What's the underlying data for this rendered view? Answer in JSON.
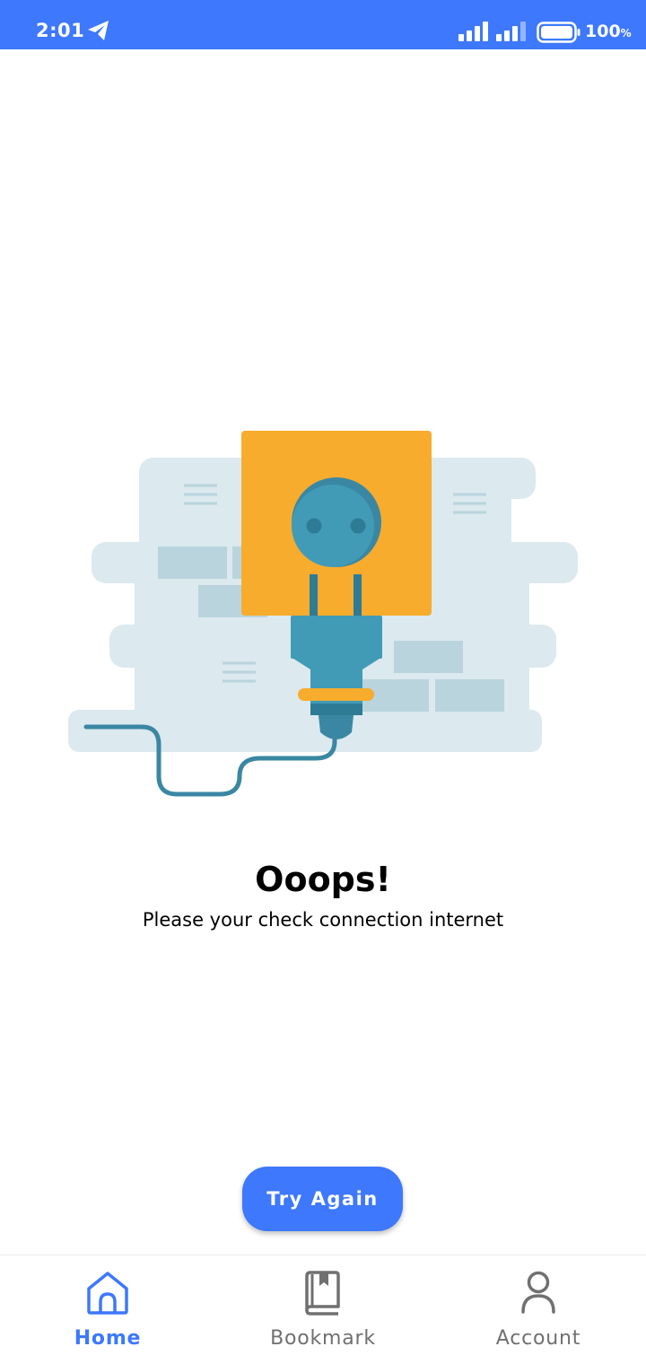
{
  "status_bar": {
    "time": "2:01",
    "battery_value": "100",
    "battery_unit": "%",
    "background_color": "#3d78fd"
  },
  "error": {
    "title": "Ooops!",
    "message": "Please your check connection internet"
  },
  "actions": {
    "retry_label": "Try Again"
  },
  "bottom_nav": {
    "items": [
      {
        "label": "Home",
        "icon": "home-icon",
        "active": true
      },
      {
        "label": "Bookmark",
        "icon": "bookmark-icon",
        "active": false
      },
      {
        "label": "Account",
        "icon": "account-icon",
        "active": false
      }
    ]
  },
  "colors": {
    "accent": "#3d78fd",
    "socket": "#f7ac2e",
    "plug": "#419bb6",
    "wall": "#dce9ee"
  }
}
